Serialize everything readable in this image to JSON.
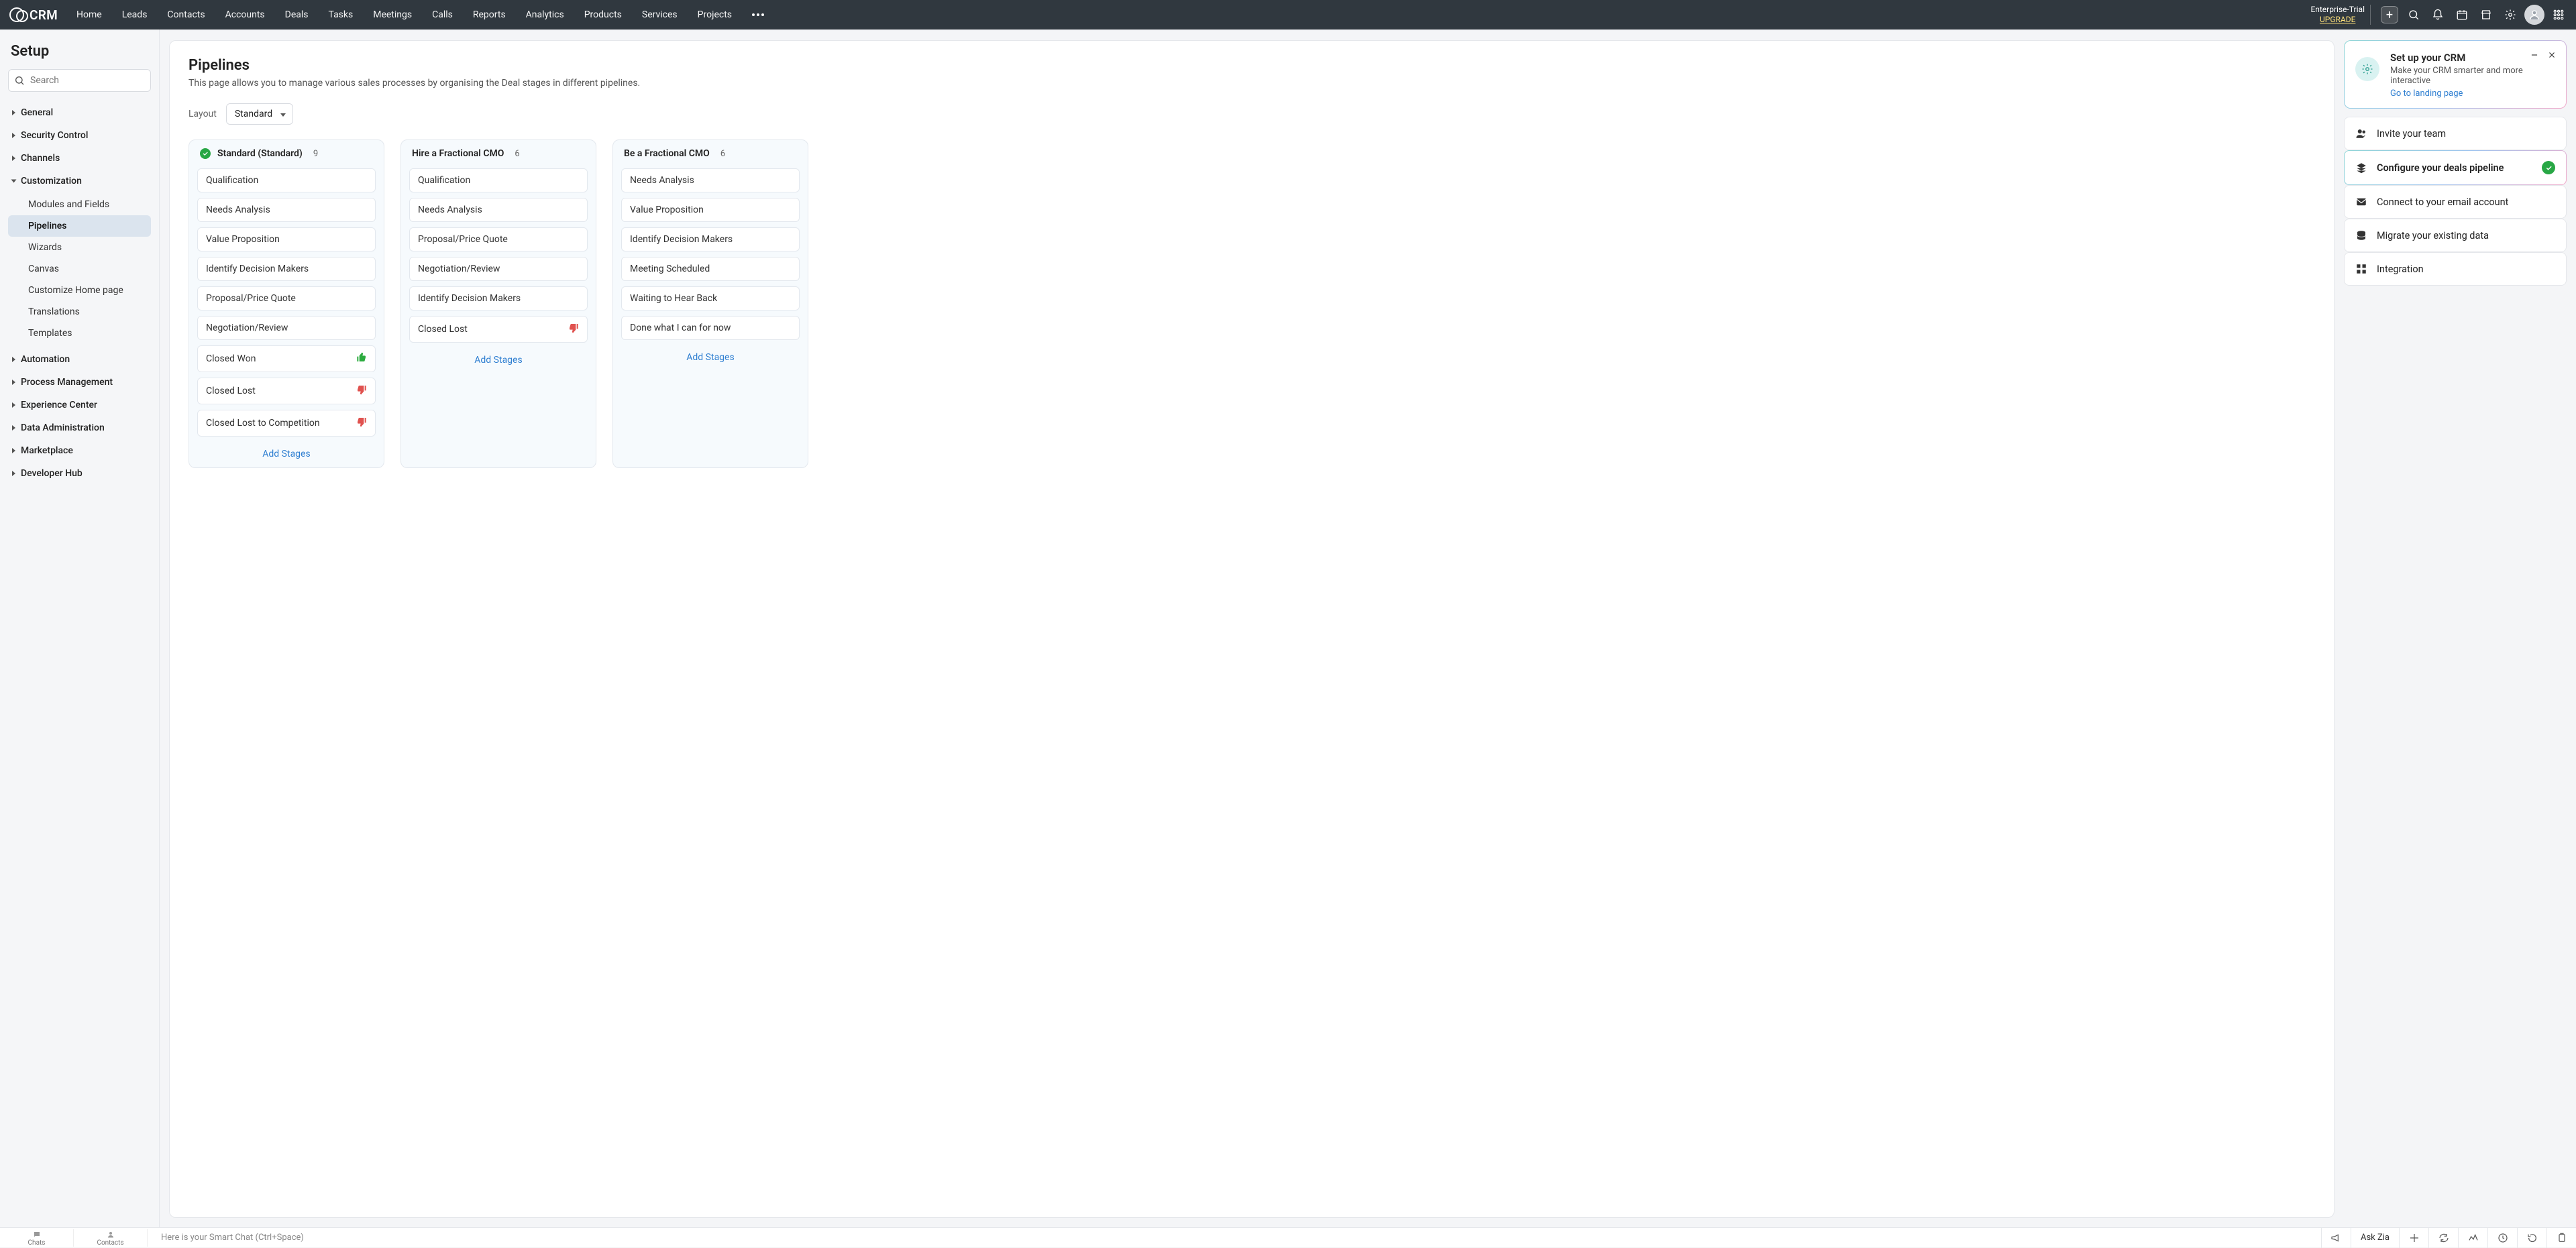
{
  "brand": "CRM",
  "nav": [
    "Home",
    "Leads",
    "Contacts",
    "Accounts",
    "Deals",
    "Tasks",
    "Meetings",
    "Calls",
    "Reports",
    "Analytics",
    "Products",
    "Services",
    "Projects"
  ],
  "trial": {
    "line1": "Enterprise-Trial",
    "upgrade": "UPGRADE"
  },
  "setup": {
    "title": "Setup",
    "searchPlaceholder": "Search",
    "groups": [
      {
        "label": "General"
      },
      {
        "label": "Security Control"
      },
      {
        "label": "Channels"
      },
      {
        "label": "Customization",
        "open": true,
        "items": [
          "Modules and Fields",
          "Pipelines",
          "Wizards",
          "Canvas",
          "Customize Home page",
          "Translations",
          "Templates"
        ],
        "selected": "Pipelines"
      },
      {
        "label": "Automation"
      },
      {
        "label": "Process Management"
      },
      {
        "label": "Experience Center"
      },
      {
        "label": "Data Administration"
      },
      {
        "label": "Marketplace"
      },
      {
        "label": "Developer Hub"
      }
    ]
  },
  "page": {
    "title": "Pipelines",
    "desc": "This page allows you to manage various sales processes by organising the Deal stages in different pipelines.",
    "layoutLabel": "Layout",
    "layoutValue": "Standard",
    "addStages": "Add Stages"
  },
  "pipelines": [
    {
      "default": true,
      "name": "Standard (Standard)",
      "count": 9,
      "stages": [
        {
          "label": "Qualification"
        },
        {
          "label": "Needs Analysis"
        },
        {
          "label": "Value Proposition"
        },
        {
          "label": "Identify Decision Makers"
        },
        {
          "label": "Proposal/Price Quote"
        },
        {
          "label": "Negotiation/Review"
        },
        {
          "label": "Closed Won",
          "thumb": "up"
        },
        {
          "label": "Closed Lost",
          "thumb": "down"
        },
        {
          "label": "Closed Lost to Competition",
          "thumb": "down"
        }
      ]
    },
    {
      "name": "Hire a Fractional CMO",
      "count": 6,
      "stages": [
        {
          "label": "Qualification"
        },
        {
          "label": "Needs Analysis"
        },
        {
          "label": "Proposal/Price Quote"
        },
        {
          "label": "Negotiation/Review"
        },
        {
          "label": "Identify Decision Makers"
        },
        {
          "label": "Closed Lost",
          "thumb": "down"
        }
      ]
    },
    {
      "name": "Be a Fractional CMO",
      "count": 6,
      "stages": [
        {
          "label": "Needs Analysis"
        },
        {
          "label": "Value Proposition"
        },
        {
          "label": "Identify Decision Makers"
        },
        {
          "label": "Meeting Scheduled"
        },
        {
          "label": "Waiting to Hear Back"
        },
        {
          "label": "Done what I can for now"
        }
      ]
    }
  ],
  "promo": {
    "title": "Set up your CRM",
    "desc": "Make your CRM smarter and more interactive",
    "link": "Go to landing page"
  },
  "tasks": [
    {
      "icon": "users",
      "label": "Invite your team"
    },
    {
      "icon": "stack",
      "label": "Configure your deals pipeline",
      "active": true,
      "done": true
    },
    {
      "icon": "mail",
      "label": "Connect to your email account"
    },
    {
      "icon": "db",
      "label": "Migrate your existing data"
    },
    {
      "icon": "grid",
      "label": "Integration"
    }
  ],
  "bottom": {
    "chats": "Chats",
    "contacts": "Contacts",
    "smart": "Here is your Smart Chat (Ctrl+Space)",
    "ask": "Ask Zia"
  }
}
